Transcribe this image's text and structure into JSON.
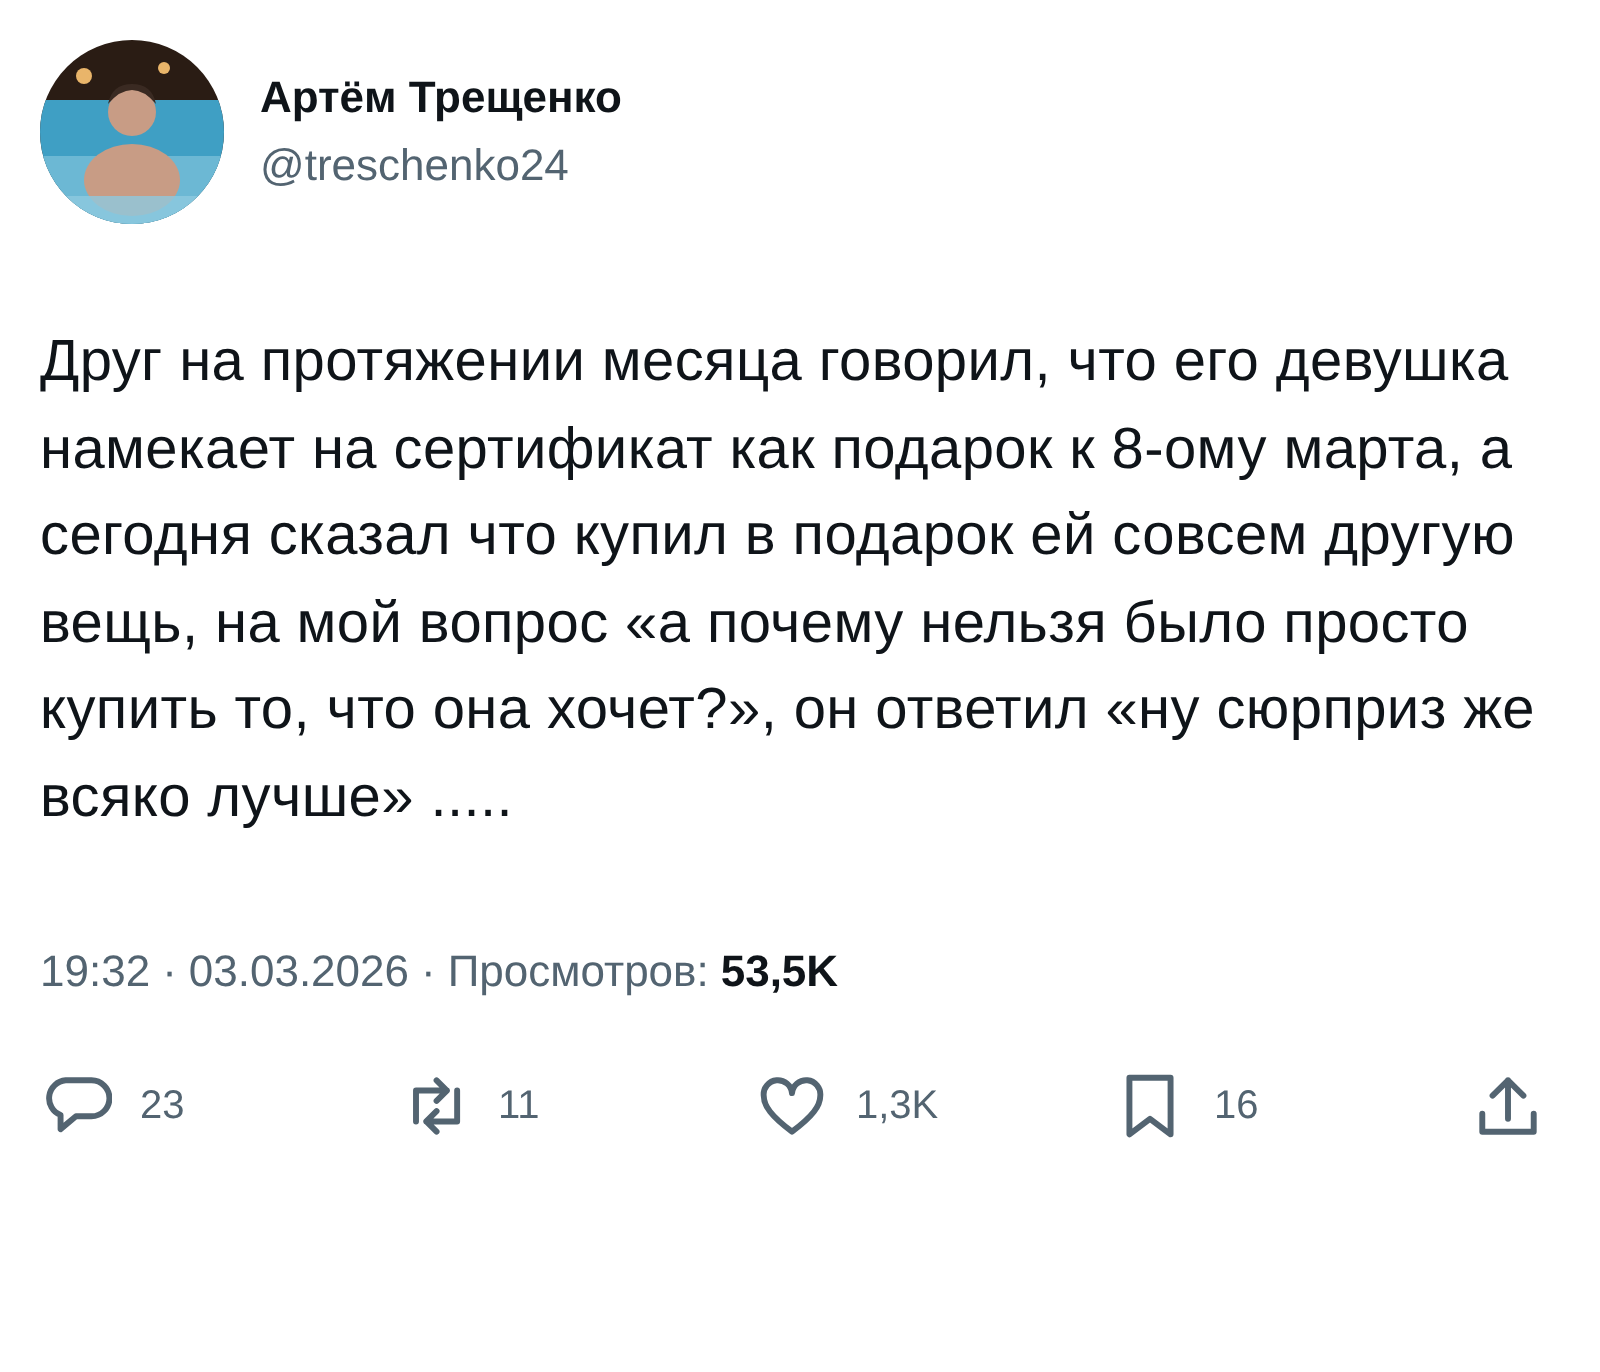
{
  "author": {
    "name": "Артём Трещенко",
    "handle": "@treschenko24"
  },
  "text": "Друг на протяжении месяца говорил, что его девушка намекает на сертификат как подарок к 8-ому марта, а сегодня сказал что купил в подарок ей совсем другую вещь, на мой вопрос «а почему нельзя было просто купить то, что она хочет?», он ответил «ну сюрприз же всяко лучше» .....",
  "meta": {
    "separator": "·",
    "time": "19:32",
    "date": "03.03.2026",
    "views_label": "Просмотров:",
    "views": "53,5K"
  },
  "actions": [
    {
      "kind": "reply",
      "count": "23"
    },
    {
      "kind": "repost",
      "count": "11"
    },
    {
      "kind": "like",
      "count": "1,3K"
    },
    {
      "kind": "bookmark",
      "count": "16"
    },
    {
      "kind": "share"
    }
  ]
}
